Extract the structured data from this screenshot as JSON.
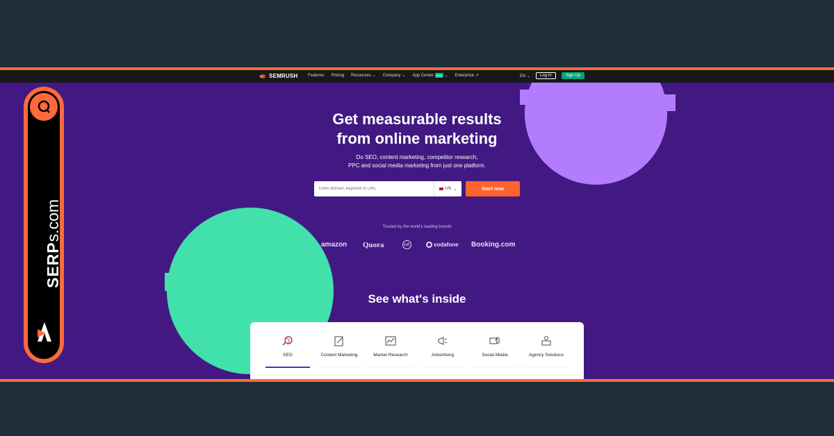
{
  "navbar": {
    "logo_text": "SEMRUSH",
    "links": [
      "Features",
      "Pricing",
      "Resources",
      "Company",
      "App Center",
      "Enterprise"
    ],
    "new_badge": "new",
    "language": "EN",
    "login_label": "Log In",
    "signup_label": "Sign Up"
  },
  "hero": {
    "title_line1": "Get measurable results",
    "title_line2": "from online marketing",
    "subtitle_line1": "Do SEO, content marketing, competitor research,",
    "subtitle_line2": "PPC and social media marketing from just one platform.",
    "search_placeholder": "Enter domain, keyword or URL",
    "country": "US",
    "start_label": "Start now"
  },
  "trusted": {
    "label": "Trusted by the world's leading brands",
    "brands": [
      "amazon",
      "Quora",
      "GE",
      "vodafone",
      "Booking.com"
    ]
  },
  "inside": {
    "title": "See what's inside",
    "tabs": [
      {
        "label": "SEO",
        "icon": "seo-icon",
        "active": true
      },
      {
        "label": "Content Marketing",
        "icon": "content-marketing-icon",
        "active": false
      },
      {
        "label": "Market Research",
        "icon": "market-research-icon",
        "active": false
      },
      {
        "label": "Advertising",
        "icon": "advertising-icon",
        "active": false
      },
      {
        "label": "Social Media",
        "icon": "social-media-icon",
        "active": false
      },
      {
        "label": "Agency Solutions",
        "icon": "agency-solutions-icon",
        "active": false
      }
    ]
  },
  "overlay": {
    "serps_bold": "SERP",
    "serps_thin": "s.com"
  },
  "colors": {
    "background": "#1f2d38",
    "accent_orange": "#ff6a3d",
    "hero_purple": "#421983",
    "blob_purple": "#b37cff",
    "blob_green": "#42e0ab",
    "start_button": "#ff642d",
    "signup_button": "#00a77c"
  }
}
